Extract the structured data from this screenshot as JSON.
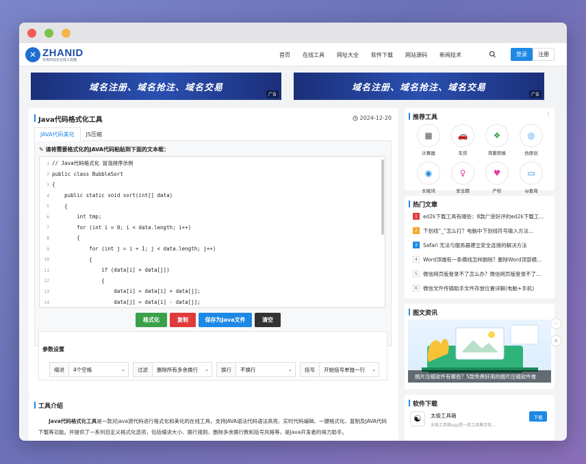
{
  "nav": {
    "logo_name": "ZHANID",
    "logo_sub": "实用的站长在线工具箱",
    "items": [
      "首页",
      "在线工具",
      "网址大全",
      "软件下载",
      "网站源码",
      "新闻技术"
    ],
    "login": "登录",
    "register": "注册"
  },
  "banners": [
    {
      "text": "域名注册、域名抢注、域名交易",
      "ad": "广告"
    },
    {
      "text": "域名注册、域名抢注、域名交易",
      "ad": "广告"
    }
  ],
  "main": {
    "title": "Java代码格式化工具",
    "date": "2024-12-20",
    "tabs": [
      "JAVA代码美化",
      "JS压缩"
    ],
    "instruction": "请将需要格式化的JAVA代码粘贴到下面的文本框：",
    "code_lines": [
      {
        "n": "1",
        "code": "// Java代码格式化 冒泡排序示例"
      },
      {
        "n": "2",
        "code": "public class BubbleSort"
      },
      {
        "n": "3",
        "code": "{"
      },
      {
        "n": "4",
        "code": "    public static void sort(int[] data)"
      },
      {
        "n": "5",
        "code": "    {"
      },
      {
        "n": "6",
        "code": "        int tmp;"
      },
      {
        "n": "7",
        "code": "        for (int i = 0; i < data.length; i++)"
      },
      {
        "n": "8",
        "code": "        {"
      },
      {
        "n": "9",
        "code": "            for (int j = i + 1; j < data.length; j++)"
      },
      {
        "n": "10",
        "code": "            {"
      },
      {
        "n": "11",
        "code": "                if (data[i] > data[j])"
      },
      {
        "n": "12",
        "code": "                {"
      },
      {
        "n": "13",
        "code": "                    data[i] = data[i] + data[j];"
      },
      {
        "n": "14",
        "code": "                    data[j] = data[i] - data[j];"
      }
    ],
    "buttons": {
      "format": "格式化",
      "copy": "复制",
      "save": "保存为Java文件",
      "clear": "清空"
    },
    "params_title": "参数设置",
    "params": [
      {
        "label": "缩进",
        "value": "4个空格"
      },
      {
        "label": "过滤",
        "value": "删除所有多余换行"
      },
      {
        "label": "换行",
        "value": "不换行"
      },
      {
        "label": "括号",
        "value": "开始括号单独一行"
      }
    ]
  },
  "intro": {
    "title": "工具介绍",
    "strong": "Java代码格式化工具",
    "text": "是一款对java源代码进行格式化和美化的在线工具，支持JAVA语法代码语法高亮、实时代码编辑、一键格式化、复制及JAVA代码下载等功能。并提供了一系列自定义格式化选项，包括缩进大小、换行规则、删除多余换行数和括号风格等，是Java开发者的得力助手。"
  },
  "sidebar": {
    "tools_title": "推荐工具",
    "tools": [
      {
        "label": "计算器",
        "icon": "▦",
        "color": "#555"
      },
      {
        "label": "车贷",
        "icon": "🚗",
        "color": "#1e88e5"
      },
      {
        "label": "简繁转换",
        "icon": "❖",
        "color": "#3aa14a"
      },
      {
        "label": "伪原创",
        "icon": "◎",
        "color": "#1e88e5"
      },
      {
        "label": "长尾词",
        "icon": "◉",
        "color": "#1e88e5"
      },
      {
        "label": "安全期",
        "icon": "♀",
        "color": "#e040a0"
      },
      {
        "label": "产检",
        "icon": "♥",
        "color": "#e040a0"
      },
      {
        "label": "ip查询",
        "icon": "▭",
        "color": "#1e88e5"
      }
    ],
    "hot_title": "热门文章",
    "hot": [
      {
        "rank": "1",
        "title": "ed2k下载工具有哪些：8款广受好评的ed2k下载工..."
      },
      {
        "rank": "2",
        "title": "下划线“_”怎么打？电脑中下划线符号输入方法..."
      },
      {
        "rank": "3",
        "title": "Safari 无法与服务器建立安全连接的解决方法"
      },
      {
        "rank": "4",
        "title": "Word顶端有一条横线怎样删除？删除Word顶部横..."
      },
      {
        "rank": "5",
        "title": "微信网页版登录不了怎么办？微信网页版登录不了..."
      },
      {
        "rank": "6",
        "title": "微信文件传输助手文件存放位置详解(电脑+手机)"
      }
    ],
    "pic_title": "图文资讯",
    "pic_caption": "图片压缩软件有哪些？5款免费好用的图片压缩软件推",
    "dl_title": "软件下载",
    "dl_name": "太极工具箱",
    "dl_desc": "太极工具箱app是一款工具聚合软...",
    "dl_btn": "下载"
  }
}
